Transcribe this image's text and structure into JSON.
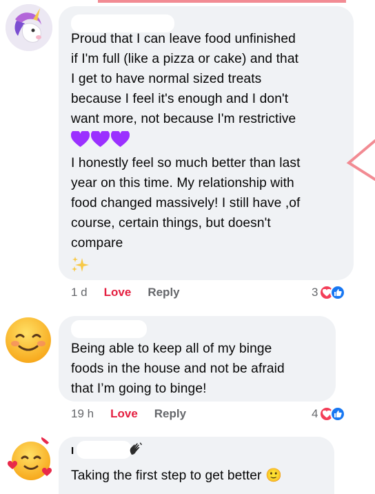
{
  "comments": [
    {
      "text_part1": "Proud that I can leave food unfinished\nif I'm full (like a pizza or cake) and that\nI get to have normal sized treats\nbecause I feel it's enough and I don't\nwant more, not because I'm restrictive",
      "text_part2": "I honestly feel so much better than last\nyear on this time. My relationship with\nfood changed massively! I still have ,of\ncourse, certain things, but doesn't\ncompare",
      "emojis": [
        "purple-heart",
        "purple-heart",
        "purple-heart",
        "sparkles"
      ],
      "time": "1 d",
      "love_label": "Love",
      "reply_label": "Reply",
      "reaction_count": "3",
      "reaction_icons": [
        "love",
        "like"
      ],
      "avatar": "unicorn"
    },
    {
      "text": "Being able to keep all of my binge\nfoods in the house and not be afraid\nthat I’m going to binge!",
      "time": "19 h",
      "love_label": "Love",
      "reply_label": "Reply",
      "reaction_count": "4",
      "reaction_icons": [
        "love",
        "like"
      ],
      "avatar": "smiling-face"
    },
    {
      "name_initial": "I",
      "text": "Taking the first step to get better 🙂",
      "name_emoji": "waving-hand",
      "avatar": "smiling-face-with-hearts"
    }
  ],
  "colors": {
    "bubble": "#f0f2f5",
    "love": "#e41e3f",
    "like": "#1877f2",
    "purple": "#9b30ff",
    "annotation": "#f28b93"
  }
}
